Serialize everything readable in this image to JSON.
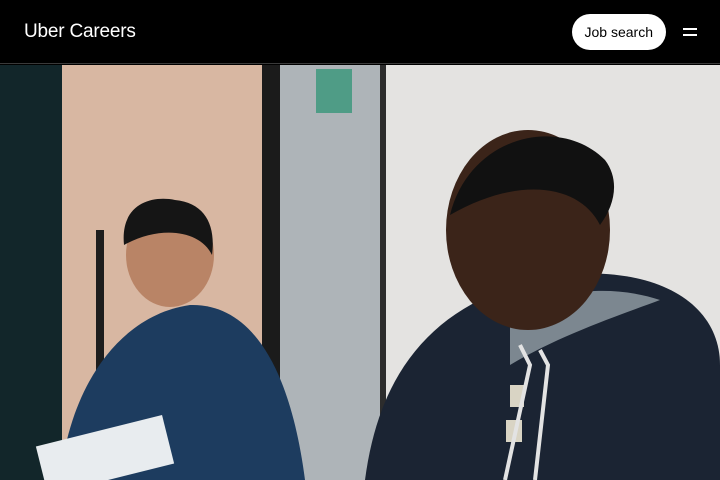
{
  "header": {
    "logo_text": "Uber Careers",
    "job_search_label": "Job search",
    "menu_icon": "hamburger-menu-icon"
  },
  "hero": {
    "image_subject": "photo"
  },
  "colors": {
    "header_bg": "#000000",
    "button_bg": "#ffffff",
    "button_text": "#000000"
  }
}
